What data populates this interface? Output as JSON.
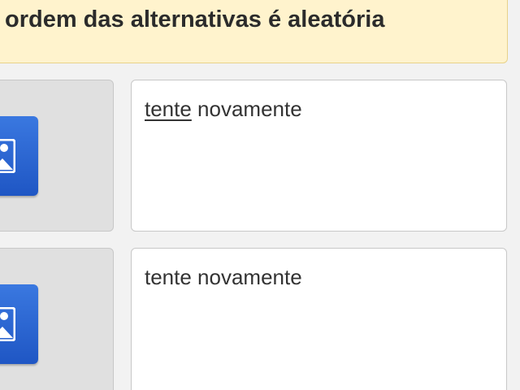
{
  "notice": {
    "text": "ordem das alternativas é aleatória"
  },
  "items": [
    {
      "image_icon": "image-icon",
      "answer_word1": "tente",
      "answer_word2": " novamente",
      "word1_underlined": true
    },
    {
      "image_icon": "image-icon",
      "answer_word1": "tente",
      "answer_word2": " novamente",
      "word1_underlined": false
    }
  ],
  "colors": {
    "notice_bg": "#fff3cd",
    "image_button": "#2a66d6",
    "image_slot_bg": "#e0e0e0",
    "text_box_bg": "#ffffff"
  }
}
